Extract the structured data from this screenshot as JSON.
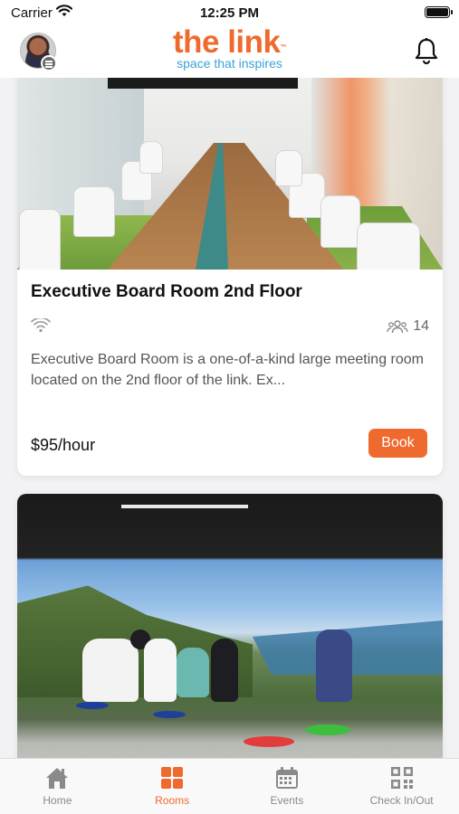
{
  "status_bar": {
    "carrier": "Carrier",
    "time": "12:25 PM"
  },
  "header": {
    "logo_title": "the link",
    "logo_tm": "™",
    "logo_tagline": "space that inspires",
    "avatar": "user-avatar",
    "notification_icon": "bell-icon"
  },
  "rooms": [
    {
      "title": "Executive Board Room 2nd Floor",
      "capacity": "14",
      "description": "Executive Board Room is a one-of-a-kind large meeting room located on the 2nd floor of the link. Ex...",
      "price": "$95/hour",
      "book_label": "Book"
    }
  ],
  "tabs": [
    {
      "label": "Home",
      "icon": "home-icon"
    },
    {
      "label": "Rooms",
      "icon": "grid-icon",
      "active": true
    },
    {
      "label": "Events",
      "icon": "calendar-icon"
    },
    {
      "label": "Check In/Out",
      "icon": "qr-code-icon"
    }
  ],
  "colors": {
    "accent": "#ef6a2e",
    "tagline": "#3aa3d8",
    "inactive": "#8a8a8a"
  }
}
